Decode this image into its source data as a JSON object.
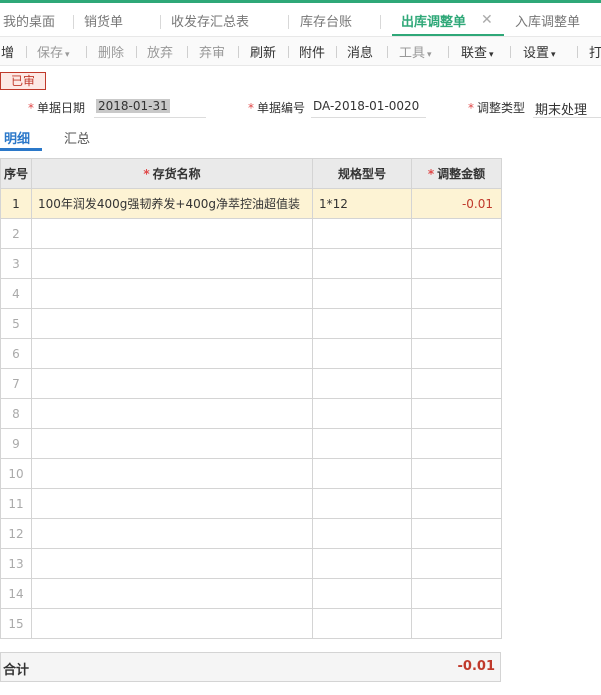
{
  "tabs": [
    {
      "label": "我的桌面"
    },
    {
      "label": "销货单"
    },
    {
      "label": "收发存汇总表"
    },
    {
      "label": "库存台账"
    },
    {
      "label": "出库调整单"
    },
    {
      "label": "入库调整单"
    }
  ],
  "toolbar": {
    "new": "增",
    "save": "保存",
    "delete": "删除",
    "discard": "放弃",
    "unaudit": "弃审",
    "refresh": "刷新",
    "attach": "附件",
    "message": "消息",
    "tools": "工具",
    "query": "联查",
    "settings": "设置",
    "print": "打"
  },
  "status_badge": "已审",
  "form": {
    "date_label": "单据日期",
    "date_value": "2018-01-31",
    "number_label": "单据编号",
    "number_value": "DA-2018-01-0020",
    "type_label": "调整类型",
    "type_value": "期末处理"
  },
  "detail_tabs": [
    {
      "label": "明细"
    },
    {
      "label": "汇总"
    }
  ],
  "grid": {
    "headers": {
      "index": "序号",
      "name": "存货名称",
      "spec": "规格型号",
      "amount": "调整金额"
    },
    "rows": [
      {
        "index": "1",
        "name": "100年润发400g强韧养发+400g净萃控油超值装",
        "spec": "1*12",
        "amount": "-0.01"
      },
      {
        "index": "2",
        "name": "",
        "spec": "",
        "amount": ""
      },
      {
        "index": "3",
        "name": "",
        "spec": "",
        "amount": ""
      },
      {
        "index": "4",
        "name": "",
        "spec": "",
        "amount": ""
      },
      {
        "index": "5",
        "name": "",
        "spec": "",
        "amount": ""
      },
      {
        "index": "6",
        "name": "",
        "spec": "",
        "amount": ""
      },
      {
        "index": "7",
        "name": "",
        "spec": "",
        "amount": ""
      },
      {
        "index": "8",
        "name": "",
        "spec": "",
        "amount": ""
      },
      {
        "index": "9",
        "name": "",
        "spec": "",
        "amount": ""
      },
      {
        "index": "10",
        "name": "",
        "spec": "",
        "amount": ""
      },
      {
        "index": "11",
        "name": "",
        "spec": "",
        "amount": ""
      },
      {
        "index": "12",
        "name": "",
        "spec": "",
        "amount": ""
      },
      {
        "index": "13",
        "name": "",
        "spec": "",
        "amount": ""
      },
      {
        "index": "14",
        "name": "",
        "spec": "",
        "amount": ""
      },
      {
        "index": "15",
        "name": "",
        "spec": "",
        "amount": ""
      }
    ]
  },
  "total": {
    "label": "合计",
    "value": "-0.01"
  },
  "colors": {
    "accent": "#2fa878",
    "detail_accent": "#2b78c9",
    "negative": "#c0392b",
    "selected_row": "#fdf3d4"
  }
}
